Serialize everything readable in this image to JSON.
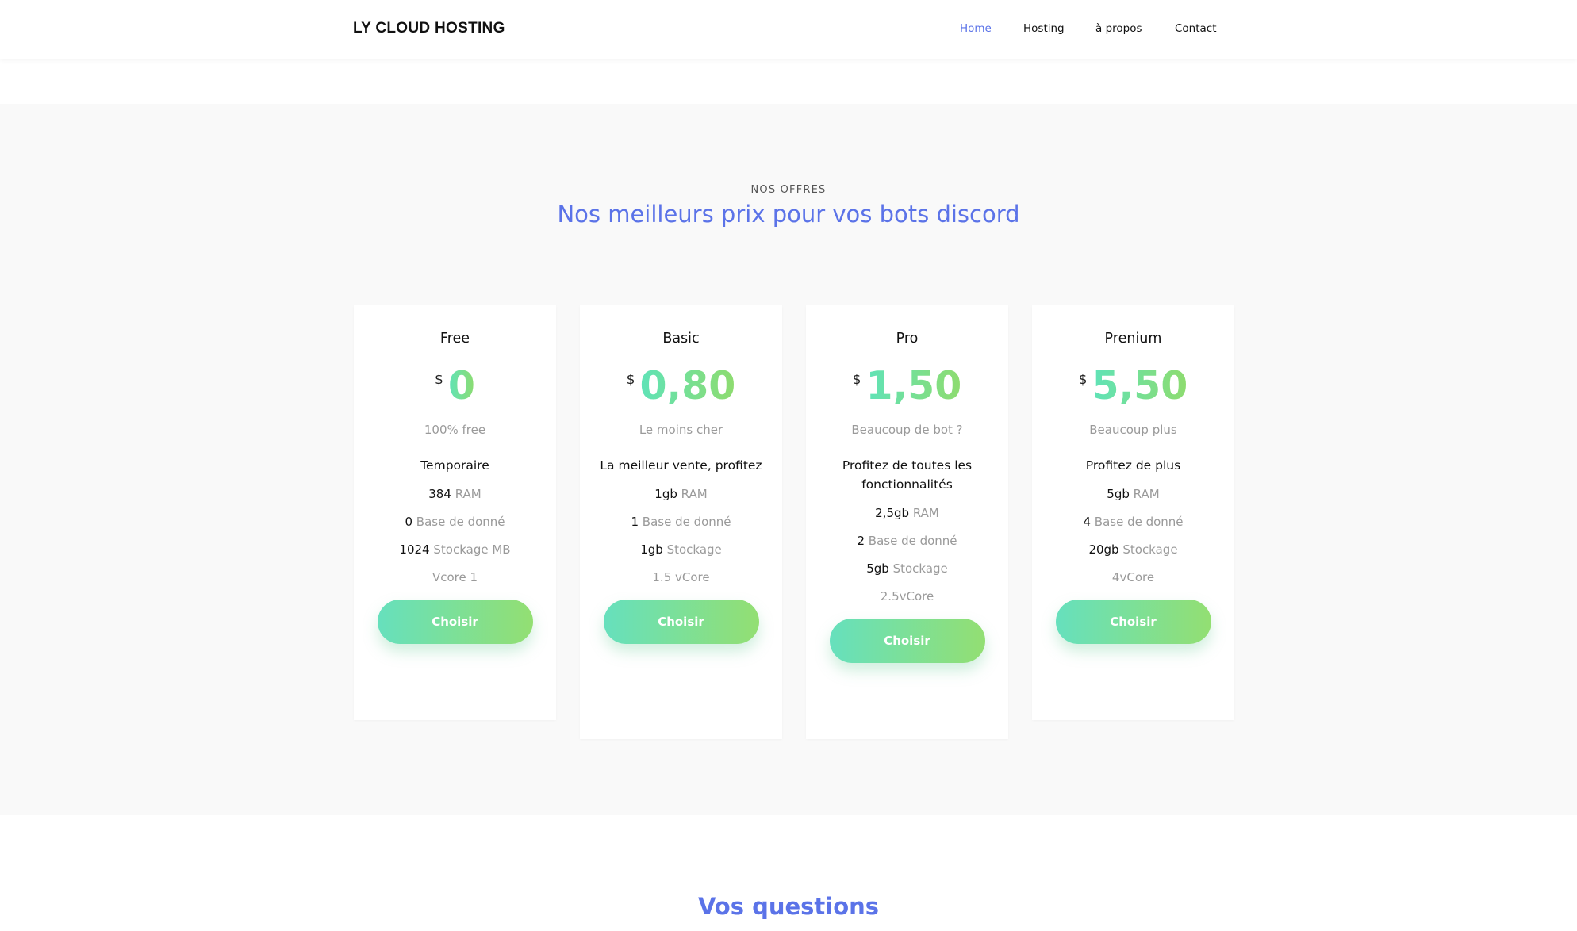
{
  "header": {
    "logo": "LY CLOUD HOSTING",
    "nav": [
      {
        "label": "Home",
        "active": true
      },
      {
        "label": "Hosting",
        "active": false
      },
      {
        "label": "à propos",
        "active": false
      },
      {
        "label": "Contact",
        "active": false
      }
    ]
  },
  "pricing": {
    "kicker": "NOS OFFRES",
    "title": "Nos meilleurs prix pour vos bots discord",
    "currency": "$",
    "plans": [
      {
        "name": "Free",
        "price": "0",
        "tagline": "100% free",
        "headline": "Temporaire",
        "features": [
          {
            "num": "384",
            "label": "RAM"
          },
          {
            "num": "0",
            "label": "Base de donné"
          },
          {
            "num": "1024",
            "label": "Stockage MB"
          },
          {
            "num": "",
            "label": "Vcore 1"
          }
        ],
        "button": "Choisir"
      },
      {
        "name": "Basic",
        "price": "0,80",
        "tagline": "Le moins cher",
        "headline": "La meilleur vente, profitez",
        "features": [
          {
            "num": "1gb",
            "label": "RAM"
          },
          {
            "num": "1",
            "label": "Base de donné"
          },
          {
            "num": "1gb",
            "label": "Stockage"
          },
          {
            "num": "",
            "label": "1.5 vCore"
          }
        ],
        "button": "Choisir"
      },
      {
        "name": "Pro",
        "price": "1,50",
        "tagline": "Beaucoup de bot ?",
        "headline": "Profitez de toutes les fonctionnalités",
        "features": [
          {
            "num": "2,5gb",
            "label": "RAM"
          },
          {
            "num": "2",
            "label": "Base de donné"
          },
          {
            "num": "5gb",
            "label": "Stockage"
          },
          {
            "num": "",
            "label": "2.5vCore"
          }
        ],
        "button": "Choisir"
      },
      {
        "name": "Prenium",
        "price": "5,50",
        "tagline": "Beaucoup plus",
        "headline": "Profitez de plus",
        "features": [
          {
            "num": "5gb",
            "label": "RAM"
          },
          {
            "num": "4",
            "label": "Base de donné"
          },
          {
            "num": "20gb",
            "label": "Stockage"
          },
          {
            "num": "",
            "label": "4vCore"
          }
        ],
        "button": "Choisir"
      }
    ]
  },
  "faq": {
    "title": "Vos questions"
  },
  "colors": {
    "accent": "#5b73e8",
    "price_gradient_start": "#5fe3b8",
    "price_gradient_end": "#8edc6f",
    "section_bg": "#f9f9f9"
  }
}
